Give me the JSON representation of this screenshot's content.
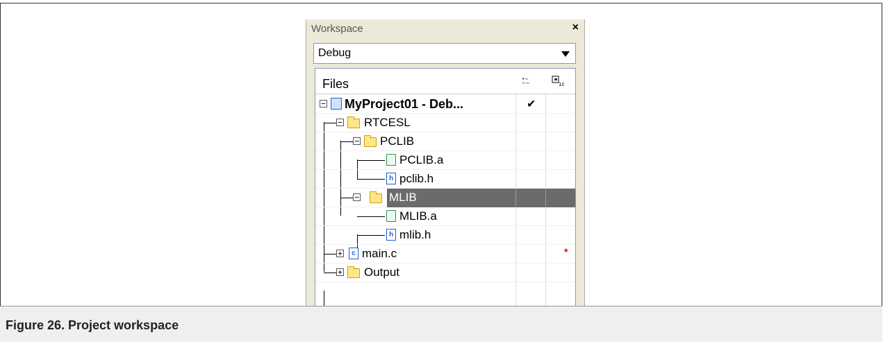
{
  "panel": {
    "title": "Workspace",
    "close_glyph": "×",
    "configuration": "Debug"
  },
  "tree": {
    "header_label": "Files",
    "header_icons": [
      "make-icon",
      "options-icon"
    ],
    "items": [
      {
        "label": "MyProject01 - Deb...",
        "icon": "project-icon",
        "checked": "✔"
      },
      {
        "label": "RTCESL",
        "icon": "folder-icon"
      },
      {
        "label": "PCLIB",
        "icon": "folder-icon"
      },
      {
        "label": "PCLIB.a",
        "icon": "library-file-icon"
      },
      {
        "label": "pclib.h",
        "icon": "header-file-icon"
      },
      {
        "label": "MLIB",
        "icon": "folder-icon",
        "selected": true
      },
      {
        "label": "MLIB.a",
        "icon": "library-file-icon"
      },
      {
        "label": "mlib.h",
        "icon": "header-file-icon"
      },
      {
        "label": "main.c",
        "icon": "c-file-icon",
        "modified": "*"
      },
      {
        "label": "Output",
        "icon": "folder-icon"
      }
    ]
  },
  "caption": "Figure 26. Project workspace"
}
